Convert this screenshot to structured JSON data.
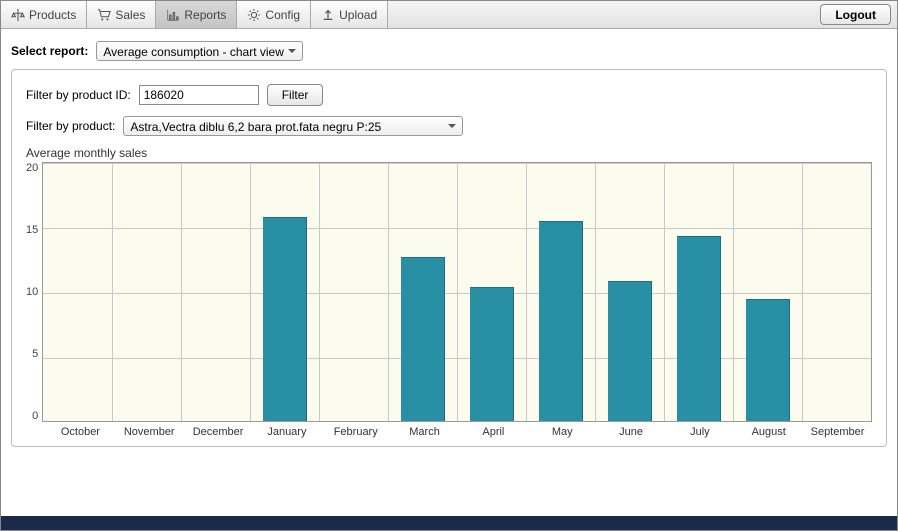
{
  "toolbar": {
    "tabs": [
      {
        "label": "Products"
      },
      {
        "label": "Sales"
      },
      {
        "label": "Reports"
      },
      {
        "label": "Config"
      },
      {
        "label": "Upload"
      }
    ],
    "logout_label": "Logout"
  },
  "select_report": {
    "label": "Select report:",
    "value": "Average consumption - chart view"
  },
  "filters": {
    "by_id_label": "Filter by product ID:",
    "id_value": "186020",
    "filter_btn": "Filter",
    "by_product_label": "Filter by product:",
    "product_value": "Astra,Vectra diblu 6,2 bara prot.fata negru P:25"
  },
  "chart_data": {
    "type": "bar",
    "title": "Average monthly sales",
    "xlabel": "",
    "ylabel": "",
    "ylim": [
      0,
      20
    ],
    "yticks": [
      0,
      5,
      10,
      15,
      20
    ],
    "categories": [
      "October",
      "November",
      "December",
      "January",
      "February",
      "March",
      "April",
      "May",
      "June",
      "July",
      "August",
      "September"
    ],
    "values": [
      0,
      0,
      0,
      15.7,
      0,
      12.6,
      10.3,
      15.4,
      10.8,
      14.2,
      9.4,
      0
    ]
  }
}
